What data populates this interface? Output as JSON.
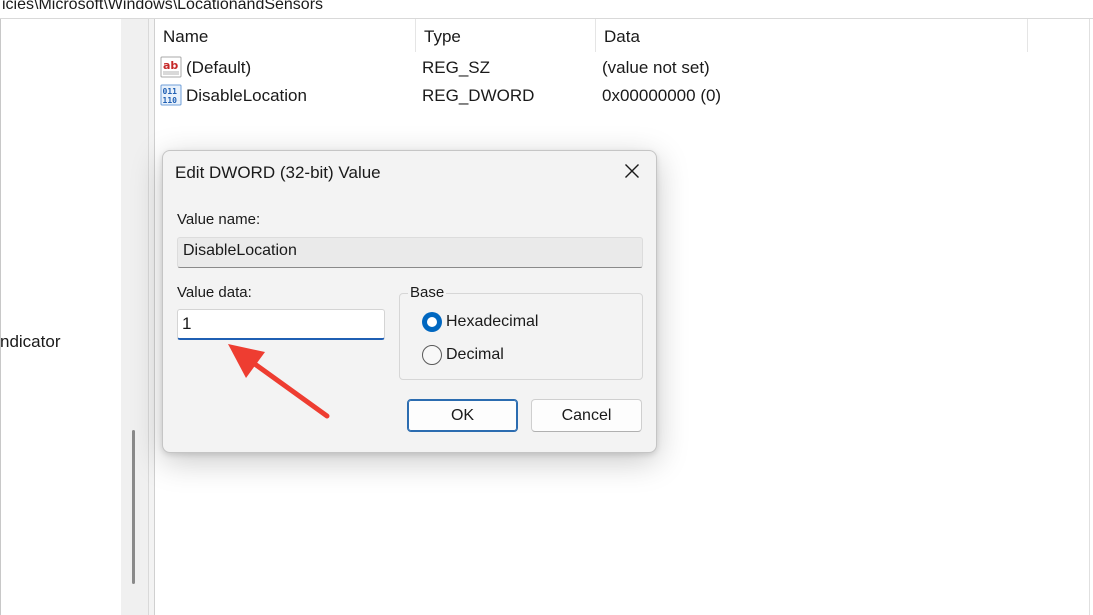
{
  "address_bar": {
    "path": "icies\\Microsoft\\Windows\\LocationandSensors"
  },
  "tree": {
    "visible_item": "ndicator"
  },
  "values_pane": {
    "columns": [
      "Name",
      "Type",
      "Data"
    ],
    "rows": [
      {
        "icon": "string-value-icon",
        "name": "(Default)",
        "type": "REG_SZ",
        "data": "(value not set)"
      },
      {
        "icon": "binary-value-icon",
        "name": "DisableLocation",
        "type": "REG_DWORD",
        "data": "0x00000000 (0)"
      }
    ]
  },
  "dialog": {
    "title": "Edit DWORD (32-bit) Value",
    "close_icon": "close-icon",
    "value_name_label": "Value name:",
    "value_name": "DisableLocation",
    "value_data_label": "Value data:",
    "value_data": "1",
    "base_label": "Base",
    "base_options": [
      {
        "label": "Hexadecimal",
        "selected": true
      },
      {
        "label": "Decimal",
        "selected": false
      }
    ],
    "ok_label": "OK",
    "cancel_label": "Cancel"
  },
  "colors": {
    "accent": "#0067c0",
    "annotation_arrow": "#ee3d31"
  }
}
